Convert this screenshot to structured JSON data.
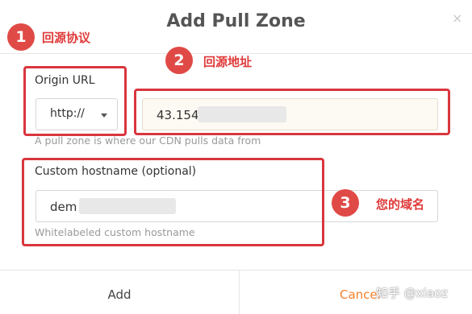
{
  "dialog": {
    "title": "Add Pull Zone",
    "close_glyph": "×"
  },
  "origin": {
    "label": "Origin URL",
    "protocol_selected": "http://",
    "url_value": "43.154",
    "hint": "A pull zone is where our CDN pulls data from"
  },
  "hostname": {
    "label": "Custom hostname (optional)",
    "value": "dem",
    "hint": "Whitelabeled custom hostname"
  },
  "annotations": [
    {
      "number": "1",
      "text": "回源协议"
    },
    {
      "number": "2",
      "text": "回源地址"
    },
    {
      "number": "3",
      "text": "您的域名"
    }
  ],
  "footer": {
    "add_label": "Add",
    "cancel_label": "Cancel"
  },
  "watermark": "知乎 @xiaoz",
  "colors": {
    "annotation_red": "#e04a46",
    "cancel_orange": "#f5812c"
  },
  "icons": [
    "close-icon",
    "chevron-down-icon"
  ]
}
